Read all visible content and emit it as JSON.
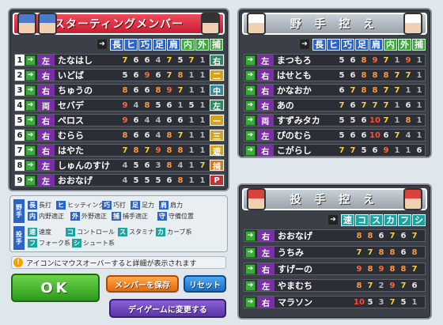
{
  "starting": {
    "title": "スターティングメンバー",
    "sort_labels": [
      "長",
      "ヒ",
      "巧",
      "足",
      "肩",
      "内",
      "外",
      "捕"
    ],
    "players": [
      {
        "order": "1",
        "hand": "左",
        "name": "たなはし",
        "stats": [
          "7",
          "6",
          "6",
          "4",
          "7",
          "5",
          "7",
          "1"
        ],
        "pos": "右",
        "pos_color": "#2f8a63"
      },
      {
        "order": "2",
        "hand": "右",
        "name": "いどば",
        "stats": [
          "5",
          "6",
          "9",
          "6",
          "7",
          "8",
          "1",
          "1"
        ],
        "pos": "二",
        "pos_color": "#d6a21e"
      },
      {
        "order": "3",
        "hand": "右",
        "name": "ちゅうの",
        "stats": [
          "8",
          "6",
          "6",
          "8",
          "9",
          "7",
          "1",
          "1"
        ],
        "pos": "中",
        "pos_color": "#2f8a9c"
      },
      {
        "order": "4",
        "hand": "両",
        "name": "セバデ",
        "stats": [
          "9",
          "4",
          "8",
          "5",
          "6",
          "1",
          "5",
          "1"
        ],
        "pos": "左",
        "pos_color": "#2f8a63"
      },
      {
        "order": "5",
        "hand": "右",
        "name": "ペロス",
        "stats": [
          "9",
          "6",
          "4",
          "4",
          "6",
          "6",
          "1",
          "1"
        ],
        "pos": "一",
        "pos_color": "#d6a21e"
      },
      {
        "order": "6",
        "hand": "右",
        "name": "むらら",
        "stats": [
          "8",
          "6",
          "6",
          "4",
          "8",
          "7",
          "1",
          "1"
        ],
        "pos": "三",
        "pos_color": "#d6a21e"
      },
      {
        "order": "7",
        "hand": "右",
        "name": "はやた",
        "stats": [
          "7",
          "8",
          "7",
          "9",
          "8",
          "8",
          "1",
          "1"
        ],
        "pos": "遊",
        "pos_color": "#d6a21e"
      },
      {
        "order": "8",
        "hand": "左",
        "name": "しゅんのすけ",
        "stats": [
          "4",
          "5",
          "6",
          "3",
          "8",
          "4",
          "1",
          "7"
        ],
        "pos": "捕",
        "pos_color": "#d67a1e"
      },
      {
        "order": "9",
        "hand": "左",
        "name": "おおなげ",
        "stats": [
          "4",
          "5",
          "5",
          "5",
          "6",
          "8",
          "1",
          "1"
        ],
        "pos": "P",
        "pos_color": "#c7302e"
      }
    ]
  },
  "bench": {
    "title": "野 手 控 え",
    "sort_labels": [
      "長",
      "ヒ",
      "巧",
      "足",
      "肩",
      "内",
      "外",
      "捕"
    ],
    "players": [
      {
        "hand": "左",
        "name": "まつもろ",
        "stats": [
          "5",
          "6",
          "8",
          "9",
          "7",
          "1",
          "9",
          "1"
        ]
      },
      {
        "hand": "右",
        "name": "はせとも",
        "stats": [
          "5",
          "6",
          "8",
          "8",
          "8",
          "7",
          "7",
          "1"
        ]
      },
      {
        "hand": "右",
        "name": "かなおか",
        "stats": [
          "6",
          "7",
          "8",
          "8",
          "7",
          "7",
          "1",
          "1"
        ]
      },
      {
        "hand": "右",
        "name": "あの",
        "stats": [
          "7",
          "6",
          "7",
          "7",
          "7",
          "1",
          "6",
          "1"
        ]
      },
      {
        "hand": "両",
        "name": "すずみタカ",
        "stats": [
          "5",
          "5",
          "6",
          "10",
          "7",
          "1",
          "8",
          "1"
        ]
      },
      {
        "hand": "左",
        "name": "ぴのむら",
        "stats": [
          "5",
          "6",
          "6",
          "10",
          "6",
          "7",
          "4",
          "1"
        ]
      },
      {
        "hand": "右",
        "name": "こがらし",
        "stats": [
          "7",
          "7",
          "5",
          "6",
          "9",
          "1",
          "1",
          "6"
        ]
      }
    ]
  },
  "pitchers": {
    "title": "投 手 控 え",
    "sort_labels": [
      "速",
      "コ",
      "ス",
      "カ",
      "フ",
      "シ"
    ],
    "players": [
      {
        "hand": "右",
        "name": "おおなげ",
        "stats": [
          "8",
          "8",
          "6",
          "7",
          "6",
          "7"
        ]
      },
      {
        "hand": "左",
        "name": "うちみ",
        "stats": [
          "7",
          "7",
          "8",
          "8",
          "6",
          "8"
        ]
      },
      {
        "hand": "右",
        "name": "すげーの",
        "stats": [
          "9",
          "8",
          "9",
          "8",
          "8",
          "7"
        ]
      },
      {
        "hand": "左",
        "name": "やまむち",
        "stats": [
          "8",
          "7",
          "2",
          "9",
          "7",
          "6"
        ]
      },
      {
        "hand": "右",
        "name": "マラソン",
        "stats": [
          "10",
          "5",
          "3",
          "7",
          "5",
          "1"
        ]
      }
    ]
  },
  "legend": {
    "batter_side": "野手",
    "pitcher_side": "投手",
    "batter": [
      {
        "k": "長",
        "v": "長打"
      },
      {
        "k": "ヒ",
        "v": "ヒッティング"
      },
      {
        "k": "巧",
        "v": "巧打"
      },
      {
        "k": "足",
        "v": "足力"
      },
      {
        "k": "肩",
        "v": "肩力"
      },
      {
        "k": "内",
        "v": "内野適正"
      },
      {
        "k": "外",
        "v": "外野適正"
      },
      {
        "k": "捕",
        "v": "捕手適正"
      },
      {
        "k": "守",
        "v": "守備位置"
      }
    ],
    "pitcher": [
      {
        "k": "速",
        "v": "速度"
      },
      {
        "k": "コ",
        "v": "コントロール"
      },
      {
        "k": "ス",
        "v": "スタミナ"
      },
      {
        "k": "カ",
        "v": "カーブ系"
      },
      {
        "k": "フ",
        "v": "フォーク系"
      },
      {
        "k": "シ",
        "v": "シュート系"
      }
    ]
  },
  "info_text": "アイコンにマウスオーバーすると詳細が表示されます",
  "buttons": {
    "ok": "OK",
    "save": "メンバーを保存",
    "reset": "リセット",
    "day_game": "デイゲームに変更する"
  }
}
